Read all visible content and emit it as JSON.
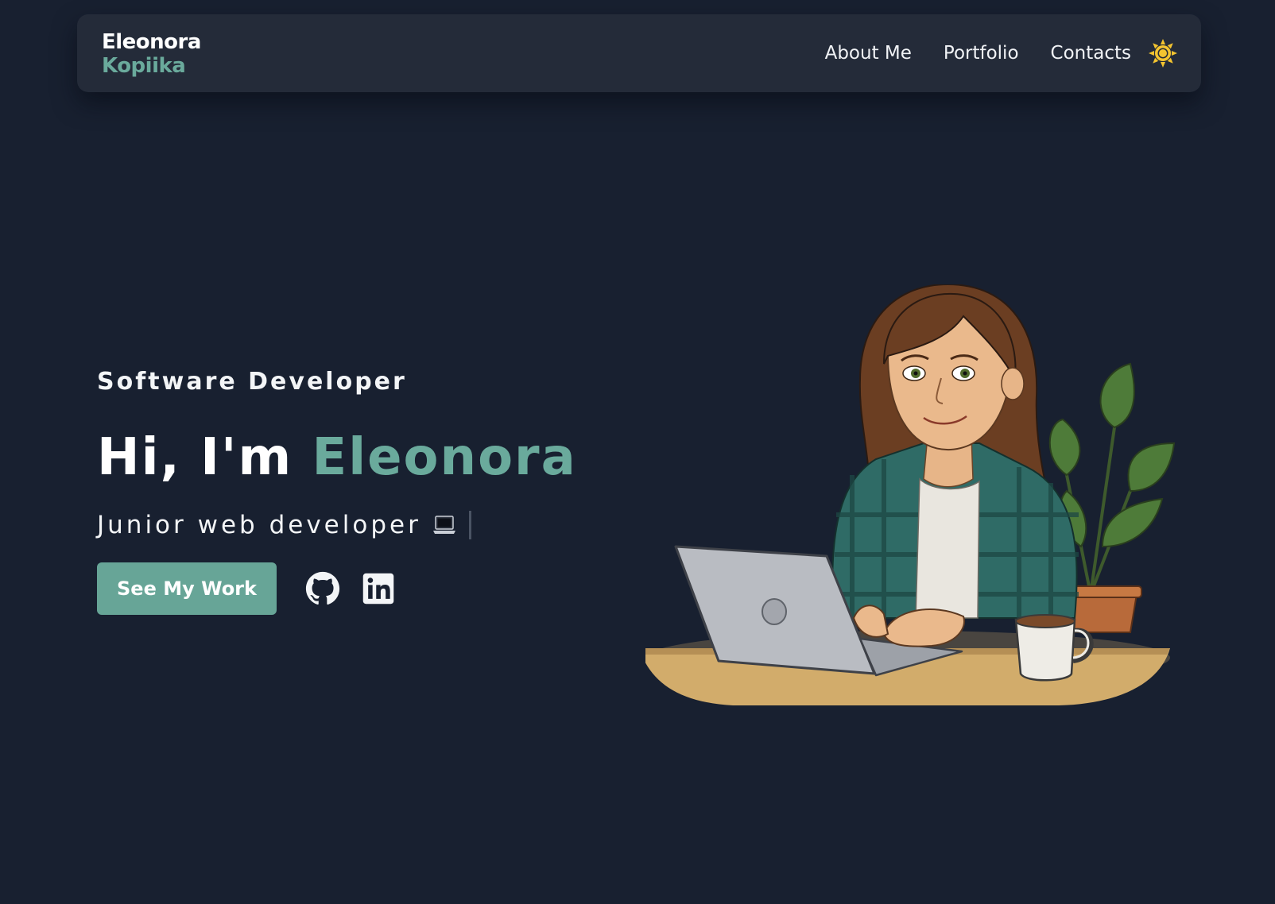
{
  "header": {
    "logo_first": "Eleonora",
    "logo_last": "Kopiika",
    "nav": [
      {
        "label": "About Me"
      },
      {
        "label": "Portfolio"
      },
      {
        "label": "Contacts"
      }
    ],
    "theme_icon": "sun-icon"
  },
  "hero": {
    "role": "Software Developer",
    "greeting_prefix": "Hi, I'm ",
    "greeting_name": "Eleonora",
    "subtitle": "Junior web developer",
    "subtitle_icon": "laptop-emoji",
    "cta_label": "See My Work",
    "social_icons": [
      "github-icon",
      "linkedin-icon"
    ],
    "illustration": "developer-at-laptop-illustration"
  },
  "colors": {
    "background": "#182030",
    "nav_background": "#242b39",
    "accent": "#6aaa9c",
    "button": "#67a597",
    "sun": "#f4c430",
    "text": "#f3f5f7"
  }
}
